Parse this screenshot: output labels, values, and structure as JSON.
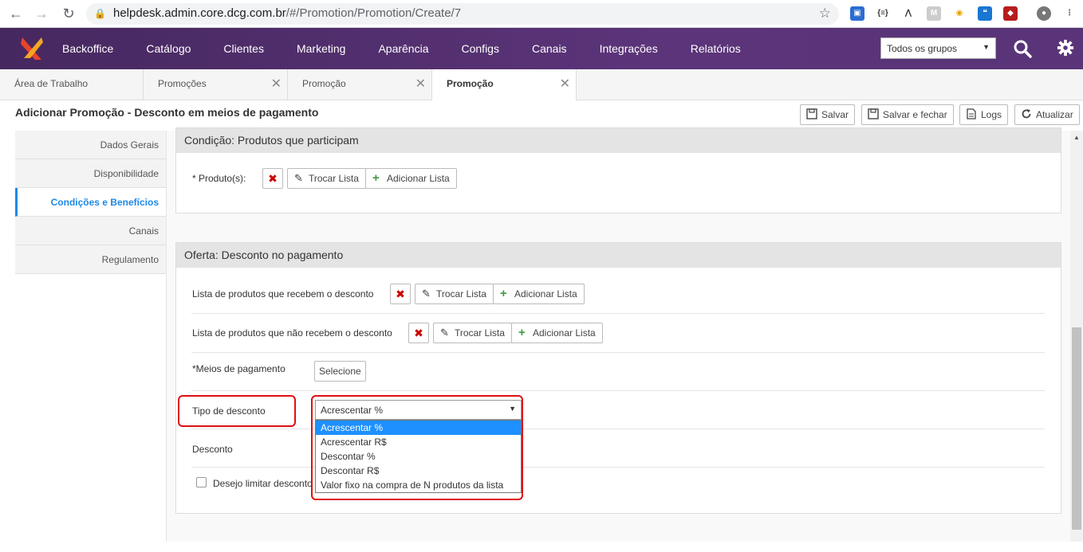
{
  "browser": {
    "url_domain": "helpdesk.admin.core.dcg.com.br",
    "url_path": "/#/Promotion/Promotion/Create/7",
    "back_icon": "arrow-left-icon",
    "forward_icon": "arrow-right-icon",
    "reload_icon": "reload-icon"
  },
  "topnav": {
    "menu": [
      "Backoffice",
      "Catálogo",
      "Clientes",
      "Marketing",
      "Aparência",
      "Configs",
      "Canais",
      "Integrações",
      "Relatórios"
    ],
    "group_select": "Todos os grupos"
  },
  "tabs": [
    {
      "label": "Área de Trabalho"
    },
    {
      "label": "Promoções"
    },
    {
      "label": "Promoção"
    },
    {
      "label": "Promoção"
    }
  ],
  "page": {
    "title": "Adicionar Promoção - Desconto em meios de pagamento",
    "toolbar": {
      "save": "Salvar",
      "save_close": "Salvar e fechar",
      "logs": "Logs",
      "refresh": "Atualizar"
    }
  },
  "sidebar": {
    "items": [
      "Dados Gerais",
      "Disponibilidade",
      "Condições e Benefícios",
      "Canais",
      "Regulamento"
    ],
    "active_index": 2
  },
  "condition_panel": {
    "header": "Condição: Produtos que participam",
    "products_label": "* Produto(s):",
    "swap_list": "Trocar Lista",
    "add_list": "Adicionar Lista"
  },
  "offer_panel": {
    "header": "Oferta: Desconto no pagamento",
    "included_label": "Lista de produtos que recebem o desconto",
    "excluded_label": "Lista de produtos que não recebem o desconto",
    "swap_list": "Trocar Lista",
    "add_list": "Adicionar Lista",
    "payment_label": "*Meios de pagamento",
    "payment_button": "Selecione",
    "discount_type_label": "Tipo de desconto",
    "discount_type_value": "Acrescentar %",
    "discount_label": "Desconto",
    "limit_label": "Desejo limitar desconto",
    "discount_type_options": [
      "Acrescentar %",
      "Acrescentar R$",
      "Descontar %",
      "Descontar R$",
      "Valor fixo na compra de N produtos da lista"
    ],
    "selected_option_index": 0
  },
  "colors": {
    "nav_bg": "#5b3479",
    "accent": "#1e88e5",
    "highlight": "#e01010"
  }
}
